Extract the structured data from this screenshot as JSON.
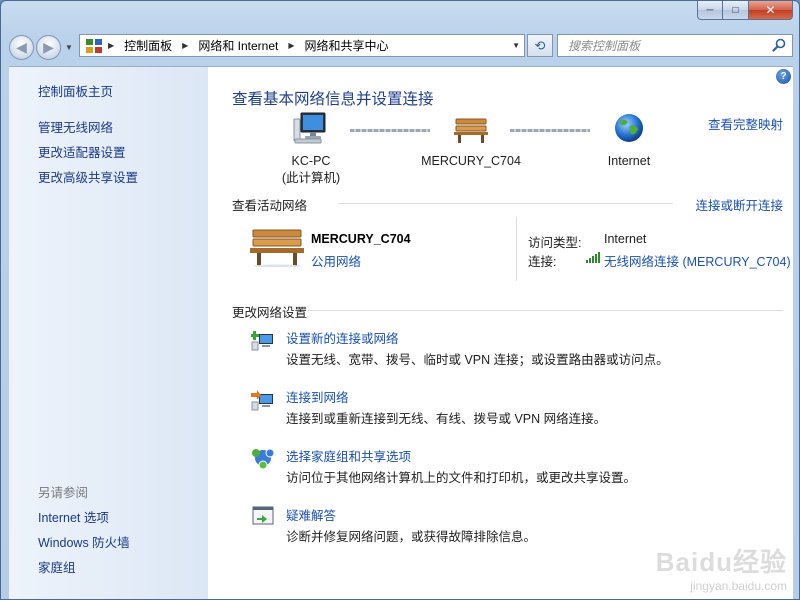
{
  "window": {
    "caption": {
      "minimize": "─",
      "maximize": "□",
      "close": "✕"
    }
  },
  "nav": {
    "back_glyph": "◀",
    "forward_glyph": "▶",
    "breadcrumbs": [
      "控制面板",
      "网络和 Internet",
      "网络和共享中心"
    ],
    "refresh_glyph": "⟲",
    "search_placeholder": "搜索控制面板"
  },
  "sidebar": {
    "items": [
      "控制面板主页",
      "管理无线网络",
      "更改适配器设置",
      "更改高级共享设置"
    ],
    "see_also_heading": "另请参阅",
    "see_also": [
      "Internet 选项",
      "Windows 防火墙",
      "家庭组"
    ]
  },
  "main": {
    "help_glyph": "?",
    "title": "查看基本网络信息并设置连接",
    "full_map_link": "查看完整映射",
    "map": {
      "computer": {
        "line1": "KC-PC",
        "line2": "(此计算机)",
        "icon": "computer-icon"
      },
      "network": {
        "name": "MERCURY_C704",
        "icon": "bench-icon"
      },
      "internet": {
        "name": "Internet",
        "icon": "globe-icon"
      }
    },
    "active_networks": {
      "heading": "查看活动网络",
      "connect_link": "连接或断开连接",
      "network_name": "MERCURY_C704",
      "network_type": "公用网络",
      "access_type_label": "访问类型:",
      "access_type_value": "Internet",
      "connection_label": "连接:",
      "connection_value": "无线网络连接 (MERCURY_C704)"
    },
    "change_settings": {
      "heading": "更改网络设置",
      "tasks": [
        {
          "link": "设置新的连接或网络",
          "desc": "设置无线、宽带、拨号、临时或 VPN 连接；或设置路由器或访问点。",
          "icon": "new-connection-icon"
        },
        {
          "link": "连接到网络",
          "desc": "连接到或重新连接到无线、有线、拨号或 VPN 网络连接。",
          "icon": "connect-network-icon"
        },
        {
          "link": "选择家庭组和共享选项",
          "desc": "访问位于其他网络计算机上的文件和打印机，或更改共享设置。",
          "icon": "homegroup-icon"
        },
        {
          "link": "疑难解答",
          "desc": "诊断并修复网络问题，或获得故障排除信息。",
          "icon": "troubleshoot-icon"
        }
      ]
    }
  },
  "watermark": {
    "logo": "Baidu经验",
    "url": "jingyan.baidu.com"
  }
}
